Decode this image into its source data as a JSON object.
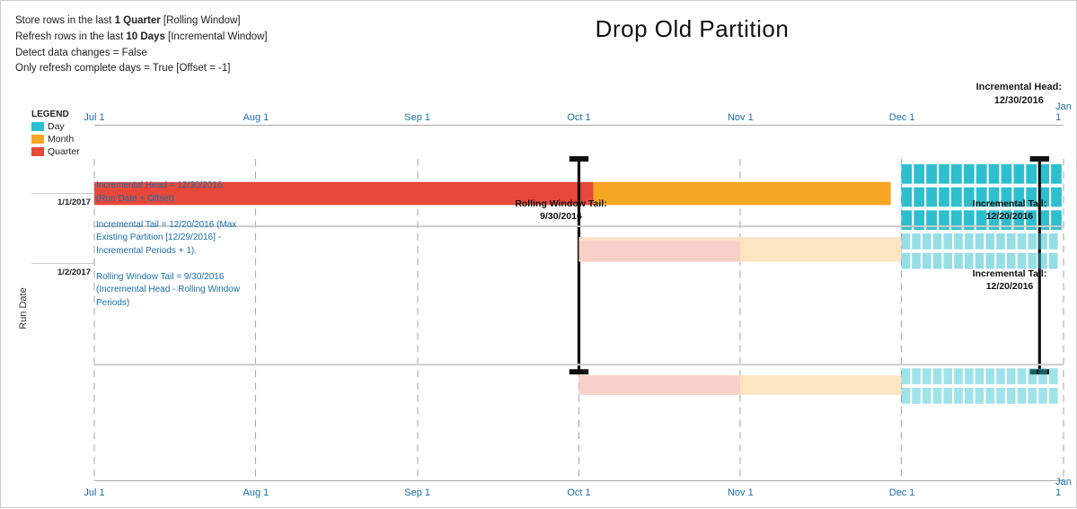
{
  "title": "Drop Old Partition",
  "info": {
    "line1_prefix": "Store rows in the last ",
    "line1_bold": "1 Quarter",
    "line1_suffix": " [Rolling Window]",
    "line2_prefix": "Refresh rows in the last ",
    "line2_bold": "10 Days",
    "line2_suffix": " [Incremental Window]",
    "line3": "Detect data changes = False",
    "line4": "Only refresh complete days = True [Offset = -1]"
  },
  "incremental_head_label": "Incremental Head:\n12/30/2016",
  "axis_labels": [
    "Jul 1",
    "Aug 1",
    "Sep 1",
    "Oct 1",
    "Nov 1",
    "Dec 1",
    "Jan 1"
  ],
  "legend": {
    "title": "LEGEND",
    "items": [
      {
        "label": "Day",
        "color": "#2ebfcf"
      },
      {
        "label": "Month",
        "color": "#f5a623"
      },
      {
        "label": "Quarter",
        "color": "#e8483a"
      }
    ]
  },
  "y_axis_label": "Run Date",
  "run_dates": [
    "1/1/2017",
    "1/2/2017"
  ],
  "annotations": {
    "rolling_window_tail": "Rolling Window Tail:\n9/30/2016",
    "incremental_tail_1": "Incremental Tail:\n12/20/2016",
    "incremental_tail_2": "Incremental Tail:\n12/20/2016"
  },
  "info_panel": {
    "line1": "Incremental Head = 12/30/2016\n(Run Date + Offset)",
    "line2": "Incremental Tail = 12/20/2016 (Max\nExisting Partition [12/29/2016] -\nIncremental Periods + 1).",
    "line3": "Rolling Window Tail = 9/30/2016\n(Incremental Head - Rolling Window\nPeriods)"
  }
}
